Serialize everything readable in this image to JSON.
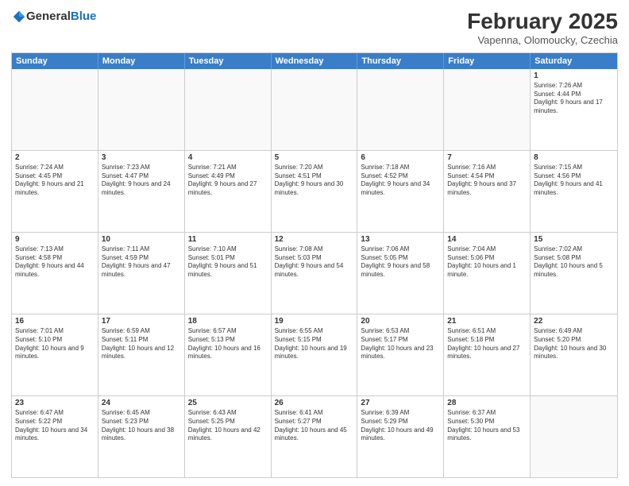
{
  "logo": {
    "text_general": "General",
    "text_blue": "Blue"
  },
  "title": {
    "month_year": "February 2025",
    "location": "Vapenna, Olomoucky, Czechia"
  },
  "header_days": [
    "Sunday",
    "Monday",
    "Tuesday",
    "Wednesday",
    "Thursday",
    "Friday",
    "Saturday"
  ],
  "weeks": [
    [
      {
        "day": "",
        "text": ""
      },
      {
        "day": "",
        "text": ""
      },
      {
        "day": "",
        "text": ""
      },
      {
        "day": "",
        "text": ""
      },
      {
        "day": "",
        "text": ""
      },
      {
        "day": "",
        "text": ""
      },
      {
        "day": "1",
        "text": "Sunrise: 7:26 AM\nSunset: 4:44 PM\nDaylight: 9 hours and 17 minutes."
      }
    ],
    [
      {
        "day": "2",
        "text": "Sunrise: 7:24 AM\nSunset: 4:45 PM\nDaylight: 9 hours and 21 minutes."
      },
      {
        "day": "3",
        "text": "Sunrise: 7:23 AM\nSunset: 4:47 PM\nDaylight: 9 hours and 24 minutes."
      },
      {
        "day": "4",
        "text": "Sunrise: 7:21 AM\nSunset: 4:49 PM\nDaylight: 9 hours and 27 minutes."
      },
      {
        "day": "5",
        "text": "Sunrise: 7:20 AM\nSunset: 4:51 PM\nDaylight: 9 hours and 30 minutes."
      },
      {
        "day": "6",
        "text": "Sunrise: 7:18 AM\nSunset: 4:52 PM\nDaylight: 9 hours and 34 minutes."
      },
      {
        "day": "7",
        "text": "Sunrise: 7:16 AM\nSunset: 4:54 PM\nDaylight: 9 hours and 37 minutes."
      },
      {
        "day": "8",
        "text": "Sunrise: 7:15 AM\nSunset: 4:56 PM\nDaylight: 9 hours and 41 minutes."
      }
    ],
    [
      {
        "day": "9",
        "text": "Sunrise: 7:13 AM\nSunset: 4:58 PM\nDaylight: 9 hours and 44 minutes."
      },
      {
        "day": "10",
        "text": "Sunrise: 7:11 AM\nSunset: 4:59 PM\nDaylight: 9 hours and 47 minutes."
      },
      {
        "day": "11",
        "text": "Sunrise: 7:10 AM\nSunset: 5:01 PM\nDaylight: 9 hours and 51 minutes."
      },
      {
        "day": "12",
        "text": "Sunrise: 7:08 AM\nSunset: 5:03 PM\nDaylight: 9 hours and 54 minutes."
      },
      {
        "day": "13",
        "text": "Sunrise: 7:06 AM\nSunset: 5:05 PM\nDaylight: 9 hours and 58 minutes."
      },
      {
        "day": "14",
        "text": "Sunrise: 7:04 AM\nSunset: 5:06 PM\nDaylight: 10 hours and 1 minute."
      },
      {
        "day": "15",
        "text": "Sunrise: 7:02 AM\nSunset: 5:08 PM\nDaylight: 10 hours and 5 minutes."
      }
    ],
    [
      {
        "day": "16",
        "text": "Sunrise: 7:01 AM\nSunset: 5:10 PM\nDaylight: 10 hours and 9 minutes."
      },
      {
        "day": "17",
        "text": "Sunrise: 6:59 AM\nSunset: 5:11 PM\nDaylight: 10 hours and 12 minutes."
      },
      {
        "day": "18",
        "text": "Sunrise: 6:57 AM\nSunset: 5:13 PM\nDaylight: 10 hours and 16 minutes."
      },
      {
        "day": "19",
        "text": "Sunrise: 6:55 AM\nSunset: 5:15 PM\nDaylight: 10 hours and 19 minutes."
      },
      {
        "day": "20",
        "text": "Sunrise: 6:53 AM\nSunset: 5:17 PM\nDaylight: 10 hours and 23 minutes."
      },
      {
        "day": "21",
        "text": "Sunrise: 6:51 AM\nSunset: 5:18 PM\nDaylight: 10 hours and 27 minutes."
      },
      {
        "day": "22",
        "text": "Sunrise: 6:49 AM\nSunset: 5:20 PM\nDaylight: 10 hours and 30 minutes."
      }
    ],
    [
      {
        "day": "23",
        "text": "Sunrise: 6:47 AM\nSunset: 5:22 PM\nDaylight: 10 hours and 34 minutes."
      },
      {
        "day": "24",
        "text": "Sunrise: 6:45 AM\nSunset: 5:23 PM\nDaylight: 10 hours and 38 minutes."
      },
      {
        "day": "25",
        "text": "Sunrise: 6:43 AM\nSunset: 5:25 PM\nDaylight: 10 hours and 42 minutes."
      },
      {
        "day": "26",
        "text": "Sunrise: 6:41 AM\nSunset: 5:27 PM\nDaylight: 10 hours and 45 minutes."
      },
      {
        "day": "27",
        "text": "Sunrise: 6:39 AM\nSunset: 5:29 PM\nDaylight: 10 hours and 49 minutes."
      },
      {
        "day": "28",
        "text": "Sunrise: 6:37 AM\nSunset: 5:30 PM\nDaylight: 10 hours and 53 minutes."
      },
      {
        "day": "",
        "text": ""
      }
    ]
  ]
}
